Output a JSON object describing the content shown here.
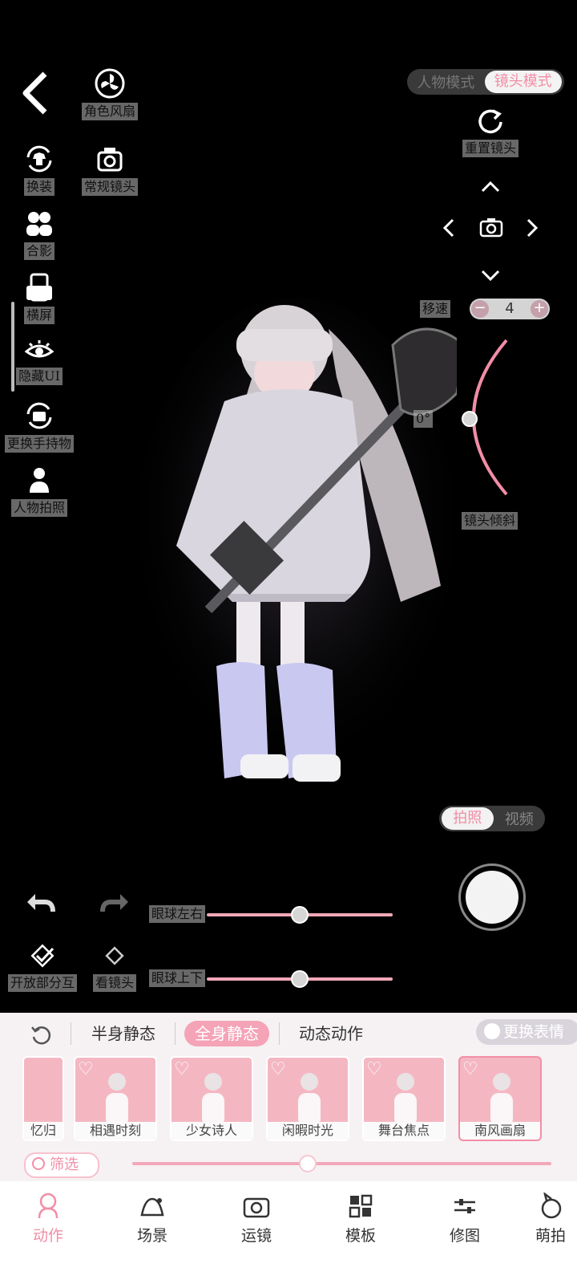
{
  "left_tools": {
    "back_label": "",
    "items": [
      {
        "label": "角色风扇",
        "icon": "fan-icon"
      },
      {
        "label": "换装",
        "icon": "outfit-swap-icon"
      },
      {
        "label": "常规镜头",
        "icon": "camera-icon"
      },
      {
        "label": "合影",
        "icon": "group-photo-icon"
      },
      {
        "label": "横屏",
        "icon": "rotate-screen-icon"
      },
      {
        "label": "隐藏UI",
        "icon": "eye-icon"
      },
      {
        "label": "更换手持物",
        "icon": "swap-item-icon"
      },
      {
        "label": "人物拍照",
        "icon": "person-icon"
      }
    ]
  },
  "mode_switch": {
    "options": [
      "人物模式",
      "镜头模式"
    ],
    "selected": "镜头模式"
  },
  "camera": {
    "reset_label": "重置镜头",
    "speed_label": "移速",
    "speed_value": "4",
    "tilt_label": "镜头倾斜",
    "tilt_value": "0°"
  },
  "capture_switch": {
    "options": [
      "拍照",
      "视频"
    ],
    "selected": "拍照"
  },
  "edit_tools": {
    "eye_lr_label": "眼球左右",
    "eye_ud_label": "眼球上下",
    "open_interact_label": "开放部分互",
    "look_camera_label": "看镜头",
    "eye_lr_value": 0.5,
    "eye_ud_value": 0.5
  },
  "panel": {
    "tabs": [
      "半身静态",
      "全身静态",
      "动态动作"
    ],
    "active_tab": "全身静态",
    "change_expression_label": "更换表情",
    "cards": [
      "忆归",
      "相遇时刻",
      "少女诗人",
      "闲暇时光",
      "舞台焦点",
      "南风画扇"
    ],
    "selected_card": "南风画扇",
    "filter_label": "筛选",
    "scroll_position": 0.4
  },
  "nav": {
    "items": [
      {
        "label": "动作",
        "icon": "pose-icon"
      },
      {
        "label": "场景",
        "icon": "scene-icon"
      },
      {
        "label": "运镜",
        "icon": "camera-move-icon"
      },
      {
        "label": "模板",
        "icon": "template-icon"
      },
      {
        "label": "修图",
        "icon": "adjust-icon"
      },
      {
        "label": "萌拍",
        "icon": "cute-icon"
      }
    ],
    "active": "动作"
  },
  "colors": {
    "accent": "#f28da6",
    "background": "#000000",
    "panel": "#f6f2f3"
  }
}
